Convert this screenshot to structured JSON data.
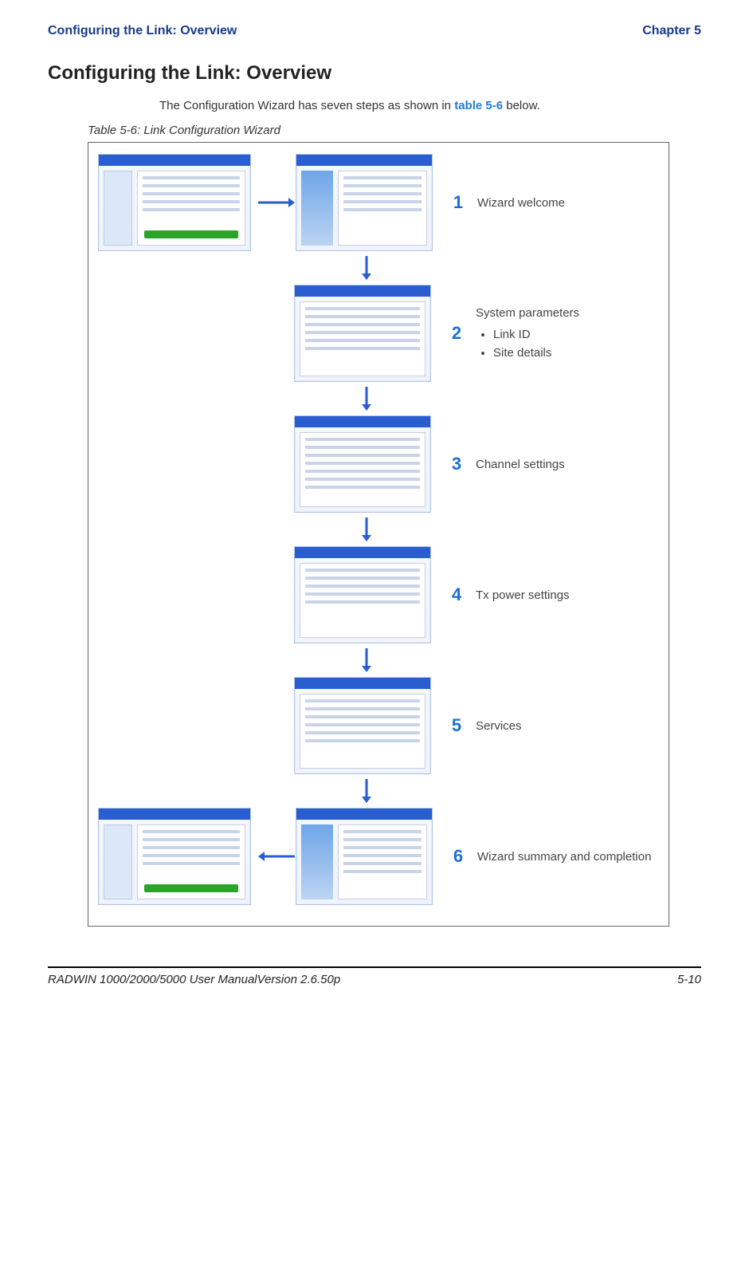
{
  "header": {
    "left": "Configuring the Link: Overview",
    "right": "Chapter 5"
  },
  "heading": "Configuring the Link: Overview",
  "intro_prefix": "The Configuration Wizard has seven steps as shown in ",
  "intro_link": "table 5-6",
  "intro_suffix": " below.",
  "table_caption": "Table 5-6: Link Configuration Wizard",
  "steps": [
    {
      "num": "1",
      "desc": "Wizard welcome"
    },
    {
      "num": "2",
      "desc_title": "System parameters",
      "items": [
        "Link ID",
        "Site details"
      ]
    },
    {
      "num": "3",
      "desc": "Channel settings"
    },
    {
      "num": "4",
      "desc": "Tx power settings"
    },
    {
      "num": "5",
      "desc": "Services"
    },
    {
      "num": "6",
      "desc": "Wizard summary and completion"
    }
  ],
  "footer": {
    "left": "RADWIN 1000/2000/5000 User ManualVersion  2.6.50p",
    "right": "5-10"
  }
}
